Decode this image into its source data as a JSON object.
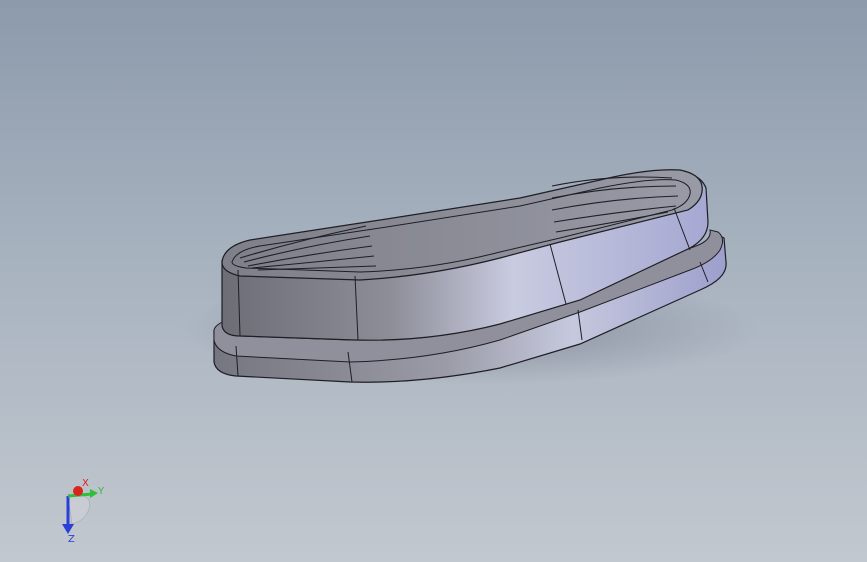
{
  "viewport": {
    "background_top": "#8c9aab",
    "background_bottom": "#c2c8cf"
  },
  "model": {
    "part_color": "#a7a9c6",
    "edge_color": "#1e1e24"
  },
  "triad": {
    "x_label": "X",
    "y_label": "Y",
    "z_label": "Z",
    "x_color": "#d8261f",
    "y_color": "#2fbf3a",
    "z_color": "#2a3fd6"
  }
}
